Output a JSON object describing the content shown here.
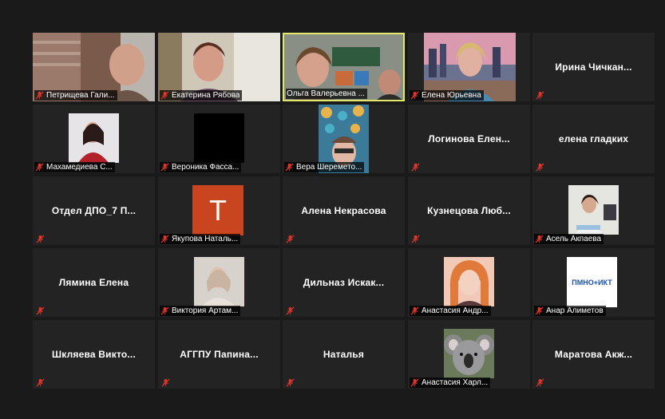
{
  "participants": [
    {
      "name": "Петрищева Гали...",
      "mode": "video"
    },
    {
      "name": "Екатерина Рябова",
      "mode": "video"
    },
    {
      "name": "Ольга Валерьевна ...",
      "mode": "video",
      "active": true
    },
    {
      "name": "Елена Юрьевна",
      "mode": "video"
    },
    {
      "name": "Ирина  Чичкан...",
      "mode": "name"
    },
    {
      "name": "Махамедиева С...",
      "mode": "thumb"
    },
    {
      "name": "Вероника Фасса...",
      "mode": "thumb"
    },
    {
      "name": "Вера Шеремето...",
      "mode": "thumb"
    },
    {
      "name": "Логинова  Елен...",
      "mode": "name"
    },
    {
      "name": "елена гладких",
      "mode": "name"
    },
    {
      "name": "Отдел  ДПО_7  П...",
      "mode": "name"
    },
    {
      "name": "Якупова Наталь...",
      "mode": "avatar",
      "letter": "T"
    },
    {
      "name": "Алена Некрасова",
      "mode": "name"
    },
    {
      "name": "Кузнецова  Люб...",
      "mode": "name"
    },
    {
      "name": "Асель Акпаева",
      "mode": "thumb"
    },
    {
      "name": "Лямина Елена",
      "mode": "name"
    },
    {
      "name": "Виктория Артам...",
      "mode": "thumb"
    },
    {
      "name": "Дильназ  Искак...",
      "mode": "name"
    },
    {
      "name": "Анастасия Андр...",
      "mode": "thumb"
    },
    {
      "name": "Анар Алиметов",
      "mode": "logo",
      "logo_text": "ПМНО+ИКТ"
    },
    {
      "name": "Шкляева  Викто...",
      "mode": "name"
    },
    {
      "name": "АГГПУ  Папина...",
      "mode": "name"
    },
    {
      "name": "Наталья",
      "mode": "name"
    },
    {
      "name": "Анастасия Харл...",
      "mode": "thumb"
    },
    {
      "name": "Маратова  Акж...",
      "mode": "name"
    }
  ],
  "colors": {
    "background": "#1a1a1a",
    "tile": "#232323",
    "active_speaker_border": "#e2e86a",
    "muted_mic": "#e0352b"
  }
}
